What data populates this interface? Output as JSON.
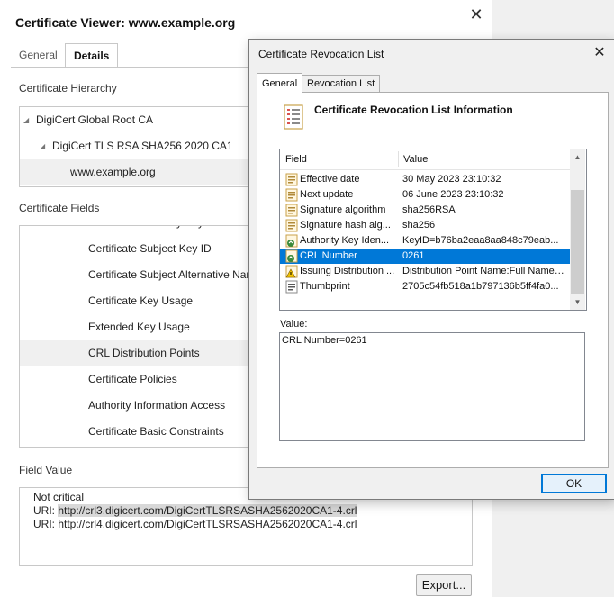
{
  "viewer": {
    "title": "Certificate Viewer: www.example.org",
    "tabs": [
      {
        "label": "General",
        "active": false
      },
      {
        "label": "Details",
        "active": true
      }
    ],
    "hierarchy_label": "Certificate Hierarchy",
    "hierarchy": [
      {
        "label": "DigiCert Global Root CA"
      },
      {
        "label": "DigiCert TLS RSA SHA256 2020 CA1"
      },
      {
        "label": "www.example.org"
      }
    ],
    "fields_label": "Certificate Fields",
    "fields": [
      {
        "label": "Certificate Subject Key ID"
      },
      {
        "label": "Certificate Subject Alternative Name"
      },
      {
        "label": "Certificate Key Usage"
      },
      {
        "label": "Extended Key Usage"
      },
      {
        "label": "CRL Distribution Points"
      },
      {
        "label": "Certificate Policies"
      },
      {
        "label": "Authority Information Access"
      },
      {
        "label": "Certificate Basic Constraints"
      }
    ],
    "field_value_label": "Field Value",
    "field_value_lines": {
      "l1": "Not critical",
      "l2_prefix": "URI: ",
      "l2_link": "http://crl3.digicert.com/DigiCertTLSRSASHA2562020CA1-4.crl",
      "l3": "URI: http://crl4.digicert.com/DigiCertTLSRSASHA2562020CA1-4.crl"
    },
    "export_label": "Export..."
  },
  "dialog": {
    "title": "Certificate Revocation List",
    "tabs": [
      {
        "label": "General",
        "active": true
      },
      {
        "label": "Revocation List",
        "active": false
      }
    ],
    "heading": "Certificate Revocation List Information",
    "columns": {
      "field": "Field",
      "value": "Value"
    },
    "rows": [
      {
        "field": "Effective date",
        "value": "30 May 2023 23:10:32",
        "icon": "field-icon"
      },
      {
        "field": "Next update",
        "value": "06 June 2023 23:10:32",
        "icon": "field-icon"
      },
      {
        "field": "Signature algorithm",
        "value": "sha256RSA",
        "icon": "field-icon"
      },
      {
        "field": "Signature hash alg...",
        "value": "sha256",
        "icon": "field-icon"
      },
      {
        "field": "Authority Key Iden...",
        "value": "KeyID=b76ba2eaa8aa848c79eab...",
        "icon": "extension-icon"
      },
      {
        "field": "CRL Number",
        "value": "0261",
        "icon": "extension-icon"
      },
      {
        "field": "Issuing Distribution ...",
        "value": "Distribution Point Name:Full Name:...",
        "icon": "critical-extension-icon"
      },
      {
        "field": "Thumbprint",
        "value": "2705c54fb518a1b797136b5ff4fa0...",
        "icon": "thumbprint-icon"
      }
    ],
    "selected_row": 5,
    "value_label": "Value:",
    "value_text": "CRL Number=0261",
    "ok_label": "OK"
  },
  "colors": {
    "selection": "#0078d7",
    "dialog_bg": "#f0f0f0"
  }
}
